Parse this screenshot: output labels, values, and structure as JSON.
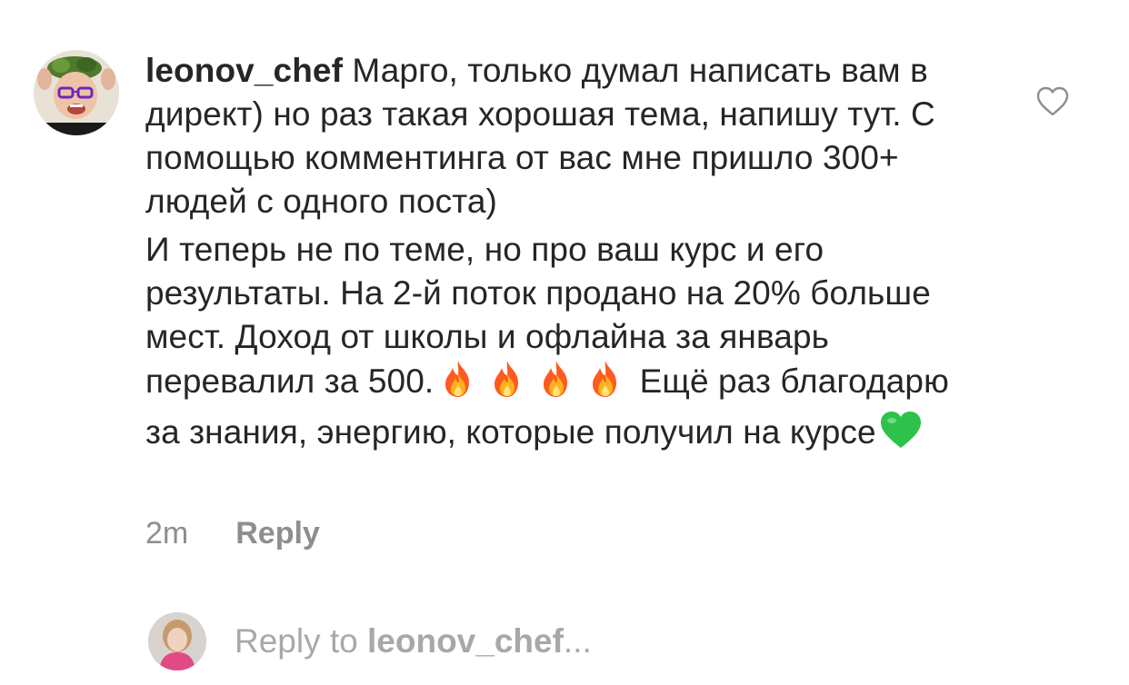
{
  "comment": {
    "username": "leonov_chef",
    "text_line1": "Марго, только думал написать вам в директ) но раз такая хорошая тема, напишу тут. С помощью комментинга от вас мне пришло 300+ людей с одного поста)",
    "para2_before": "И теперь не по теме, но про ваш курс и его результаты. На 2-й поток продано на 20% больше мест. Доход от школы и офлайна за январь перевалил за 500.",
    "para2_after": " Ещё раз благодарю за знания, энергию, которые получил на курсе",
    "emoji_fire": "fire-emoji",
    "emoji_heart": "green-heart-emoji",
    "time": "2m",
    "reply_label": "Reply",
    "like_icon": "heart-outline-icon"
  },
  "reply_bar": {
    "prefix": "Reply to ",
    "to_user": "leonov_chef",
    "suffix": "..."
  },
  "colors": {
    "text": "#262626",
    "secondary": "#8e8e8e",
    "placeholder": "#a8a8a8",
    "fire_orange": "#ff7a00",
    "green_heart": "#2ec24a"
  }
}
